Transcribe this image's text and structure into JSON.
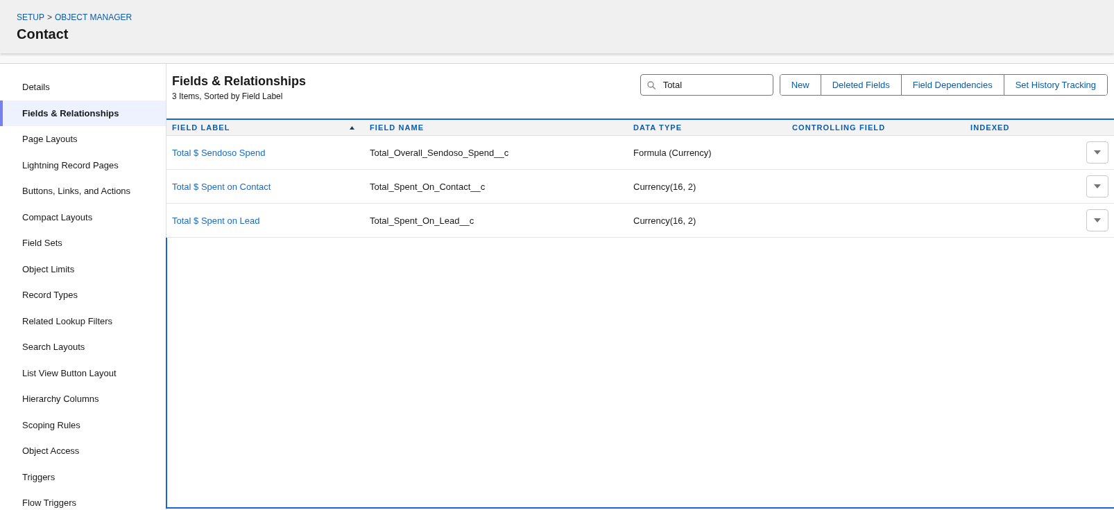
{
  "header": {
    "breadcrumbs": [
      "SETUP",
      "OBJECT MANAGER"
    ],
    "separator": ">",
    "title": "Contact"
  },
  "sidebar": {
    "items": [
      {
        "label": "Details",
        "selected": false
      },
      {
        "label": "Fields & Relationships",
        "selected": true
      },
      {
        "label": "Page Layouts",
        "selected": false
      },
      {
        "label": "Lightning Record Pages",
        "selected": false
      },
      {
        "label": "Buttons, Links, and Actions",
        "selected": false
      },
      {
        "label": "Compact Layouts",
        "selected": false
      },
      {
        "label": "Field Sets",
        "selected": false
      },
      {
        "label": "Object Limits",
        "selected": false
      },
      {
        "label": "Record Types",
        "selected": false
      },
      {
        "label": "Related Lookup Filters",
        "selected": false
      },
      {
        "label": "Search Layouts",
        "selected": false
      },
      {
        "label": "List View Button Layout",
        "selected": false
      },
      {
        "label": "Hierarchy Columns",
        "selected": false
      },
      {
        "label": "Scoping Rules",
        "selected": false
      },
      {
        "label": "Object Access",
        "selected": false
      },
      {
        "label": "Triggers",
        "selected": false
      },
      {
        "label": "Flow Triggers",
        "selected": false
      }
    ]
  },
  "content": {
    "title": "Fields & Relationships",
    "subtitle": "3 Items, Sorted by Field Label",
    "search": {
      "value": "Total"
    },
    "buttons": [
      "New",
      "Deleted Fields",
      "Field Dependencies",
      "Set History Tracking"
    ]
  },
  "table": {
    "columns": [
      {
        "label": "FIELD LABEL",
        "sorted": true
      },
      {
        "label": "FIELD NAME",
        "sorted": false
      },
      {
        "label": "DATA TYPE",
        "sorted": false
      },
      {
        "label": "CONTROLLING FIELD",
        "sorted": false
      },
      {
        "label": "INDEXED",
        "sorted": false
      }
    ],
    "rows": [
      {
        "field_label": "Total $ Sendoso Spend",
        "field_name": "Total_Overall_Sendoso_Spend__c",
        "data_type": "Formula (Currency)"
      },
      {
        "field_label": "Total $ Spent on Contact",
        "field_name": "Total_Spent_On_Contact__c",
        "data_type": "Currency(16, 2)"
      },
      {
        "field_label": "Total $ Spent on Lead",
        "field_name": "Total_Spent_On_Lead__c",
        "data_type": "Currency(16, 2)"
      }
    ]
  }
}
